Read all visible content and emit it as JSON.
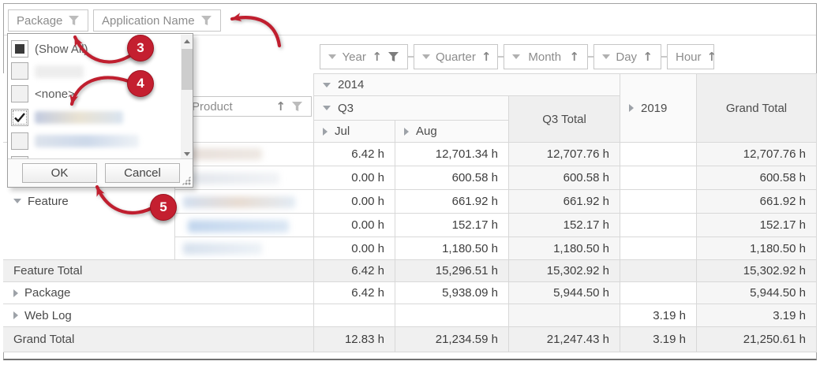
{
  "colors": {
    "annotation_red": "#c41f30",
    "grid_border": "#d8d8d8"
  },
  "filter_bar": {
    "fields": [
      {
        "label": "Package"
      },
      {
        "label": "Application Name"
      }
    ]
  },
  "column_fields": [
    {
      "label": "Year",
      "caret": true,
      "sort": "asc",
      "filtered": true
    },
    {
      "label": "Quarter",
      "caret": true,
      "sort": "asc"
    },
    {
      "label": "Month",
      "caret": true,
      "sort": "asc"
    },
    {
      "label": "Day",
      "caret": true,
      "sort": "asc"
    },
    {
      "label": "Hour",
      "caret": false,
      "sort": "asc"
    }
  ],
  "row_field": {
    "label": "Product",
    "sort": "asc",
    "filtered": false
  },
  "filter_popup": {
    "items": [
      {
        "label": "(Show All)",
        "state": "indeterminate",
        "redacted": false
      },
      {
        "label": "",
        "state": "unchecked",
        "redacted": true
      },
      {
        "label": "<none>",
        "state": "unchecked",
        "redacted": false
      },
      {
        "label": "",
        "state": "checked",
        "redacted": true
      },
      {
        "label": "",
        "state": "unchecked",
        "redacted": true
      }
    ],
    "buttons": {
      "ok": "OK",
      "cancel": "Cancel"
    }
  },
  "annotations": {
    "step3": "3",
    "step4": "4",
    "step5": "5"
  },
  "pivot": {
    "column_headers": {
      "y2014": "2014",
      "q3": "Q3",
      "jul": "Jul",
      "aug": "Aug",
      "q3_total": "Q3 Total",
      "y2019": "2019",
      "grand_total": "Grand Total"
    },
    "row_headers": {
      "feature": "Feature",
      "feature_total": "Feature Total",
      "package": "Package",
      "web_log": "Web Log",
      "grand_total": "Grand Total"
    },
    "rows": [
      {
        "kind": "detail",
        "label": "",
        "cells": [
          "6.42 h",
          "12,701.34 h",
          "12,707.76 h",
          "",
          "12,707.76 h"
        ]
      },
      {
        "kind": "detail",
        "label": "",
        "cells": [
          "0.00 h",
          "600.58 h",
          "600.58 h",
          "",
          "600.58 h"
        ]
      },
      {
        "kind": "detail",
        "label": "",
        "cells": [
          "0.00 h",
          "661.92 h",
          "661.92 h",
          "",
          "661.92 h"
        ]
      },
      {
        "kind": "detail",
        "label": "",
        "cells": [
          "0.00 h",
          "152.17 h",
          "152.17 h",
          "",
          "152.17 h"
        ]
      },
      {
        "kind": "detail",
        "label": "",
        "cells": [
          "0.00 h",
          "1,180.50 h",
          "1,180.50 h",
          "",
          "1,180.50 h"
        ]
      },
      {
        "kind": "total",
        "label": "Feature Total",
        "cells": [
          "6.42 h",
          "15,296.51 h",
          "15,302.92 h",
          "",
          "15,302.92 h"
        ]
      },
      {
        "kind": "group",
        "label": "Package",
        "cells": [
          "6.42 h",
          "5,938.09 h",
          "5,944.50 h",
          "",
          "5,944.50 h"
        ]
      },
      {
        "kind": "group",
        "label": "Web Log",
        "cells": [
          "",
          "",
          "",
          "3.19 h",
          "3.19 h"
        ]
      },
      {
        "kind": "grand",
        "label": "Grand Total",
        "cells": [
          "12.83 h",
          "21,234.59 h",
          "21,247.43 h",
          "3.19 h",
          "21,250.61 h"
        ]
      }
    ]
  }
}
